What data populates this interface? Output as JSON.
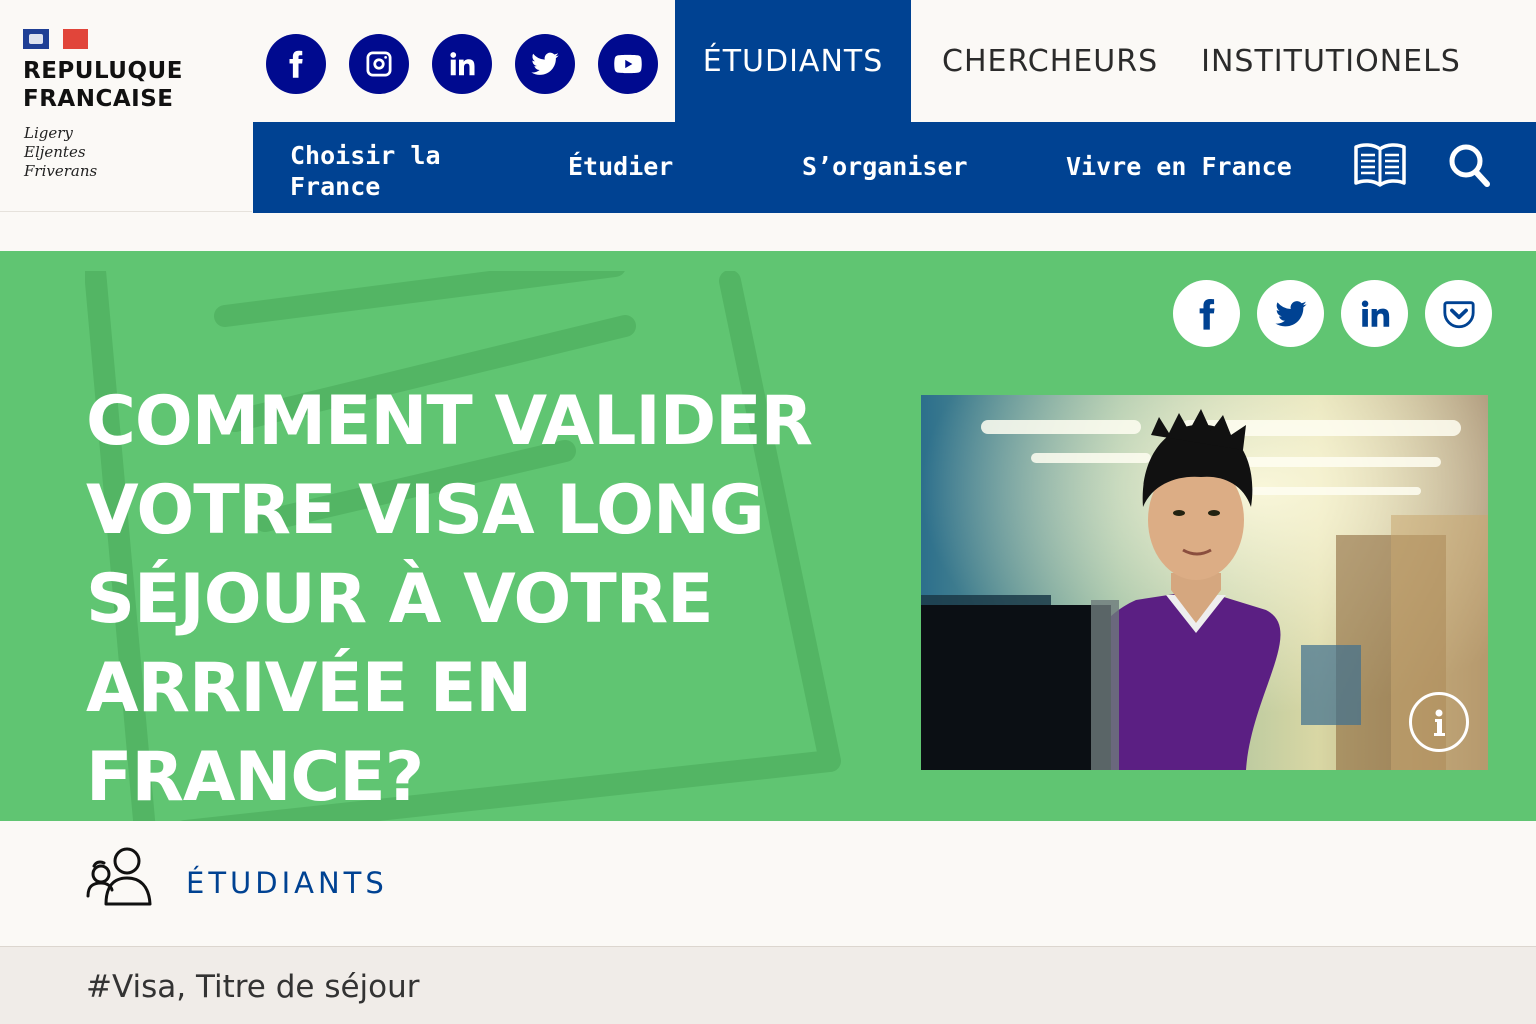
{
  "logo": {
    "line1": "REPULUQUE",
    "line2": "FRANCAISE",
    "motto": [
      "Ligery",
      "Eljentes",
      "Friverans"
    ]
  },
  "social": [
    {
      "icon": "facebook-icon"
    },
    {
      "icon": "instagram-icon"
    },
    {
      "icon": "linkedin-icon"
    },
    {
      "icon": "twitter-icon"
    },
    {
      "icon": "youtube-icon"
    }
  ],
  "main_tabs": [
    {
      "label": "ÉTUDIANTS",
      "active": true
    },
    {
      "label": "CHERCHEURS",
      "active": false
    },
    {
      "label": "INSTITUTIONELS",
      "active": false
    }
  ],
  "sub_nav": [
    {
      "label_line1": "Choisir la",
      "label_line2": "France"
    },
    {
      "label": "Étudier"
    },
    {
      "label": "S’organiser"
    },
    {
      "label": "Vivre en France"
    }
  ],
  "nav_icons": [
    "book-icon",
    "search-icon"
  ],
  "hero": {
    "title": "COMMENT VALIDER VOTRE VISA LONG SÉJOUR À VOTRE ARRIVÉE EN FRANCE?",
    "share": [
      "facebook-icon",
      "twitter-icon",
      "linkedin-icon",
      "pocket-icon"
    ],
    "info_icon": "info-icon"
  },
  "category": {
    "icon": "students-icon",
    "label": "ÉTUDIANTS"
  },
  "tags": "#Visa, Titre de séjour",
  "colors": {
    "brand_blue": "#004292",
    "social_blue": "#000a8f",
    "hero_green": "#60c572",
    "flag_blue": "#1f3f95",
    "flag_red": "#e1453a"
  }
}
